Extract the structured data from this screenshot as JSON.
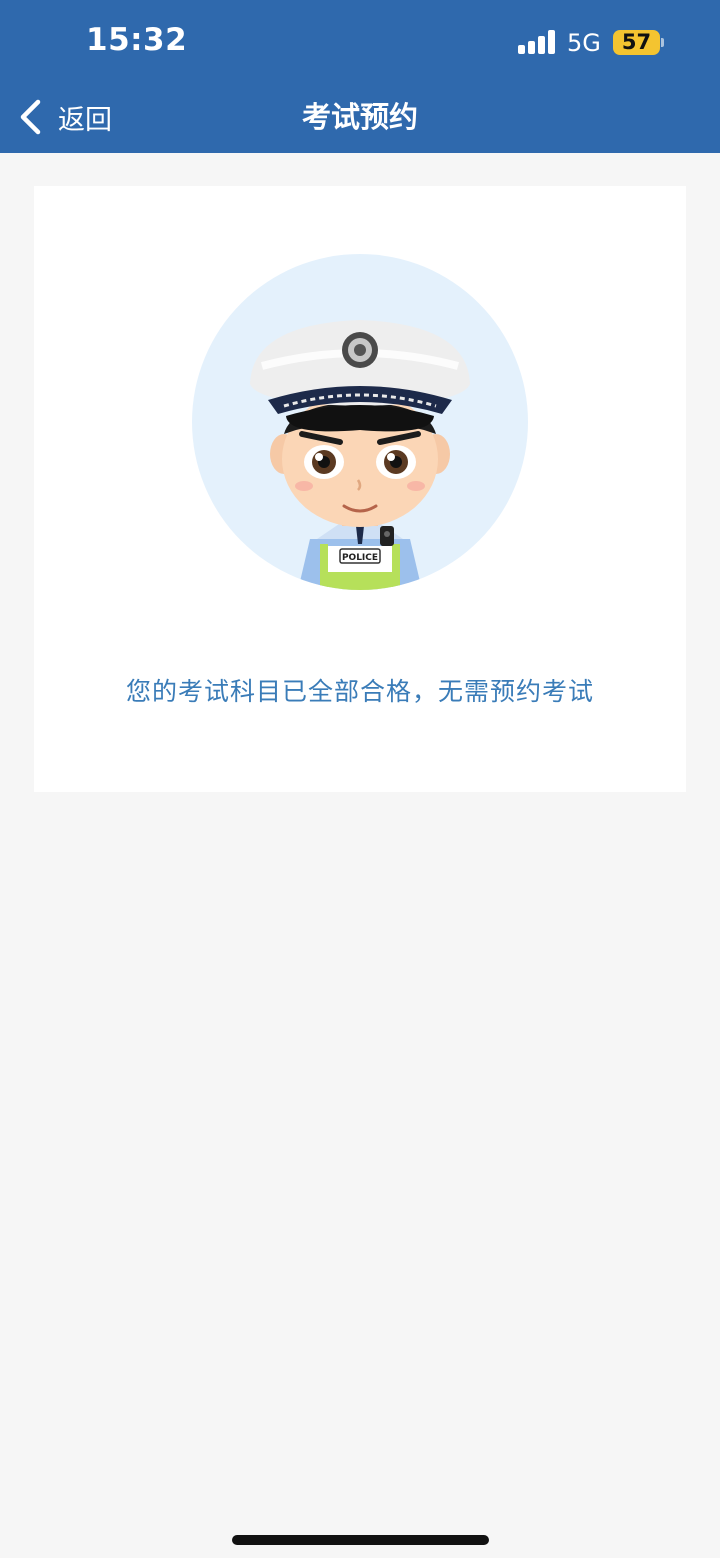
{
  "status_bar": {
    "time": "15:32",
    "network": "5G",
    "battery": "57",
    "signal_icon": "cellular-signal-icon"
  },
  "nav": {
    "back_label": "返回",
    "back_icon": "chevron-left-icon",
    "title": "考试预约"
  },
  "main": {
    "avatar_badge_text": "POLICE",
    "message": "您的考试科目已全部合格，无需预约考试"
  },
  "colors": {
    "header_bg": "#2f69ad",
    "page_bg": "#f6f6f6",
    "message_text": "#3a7cb8",
    "battery_fill": "#f4c430",
    "avatar_circle": "#e4f1fc"
  }
}
